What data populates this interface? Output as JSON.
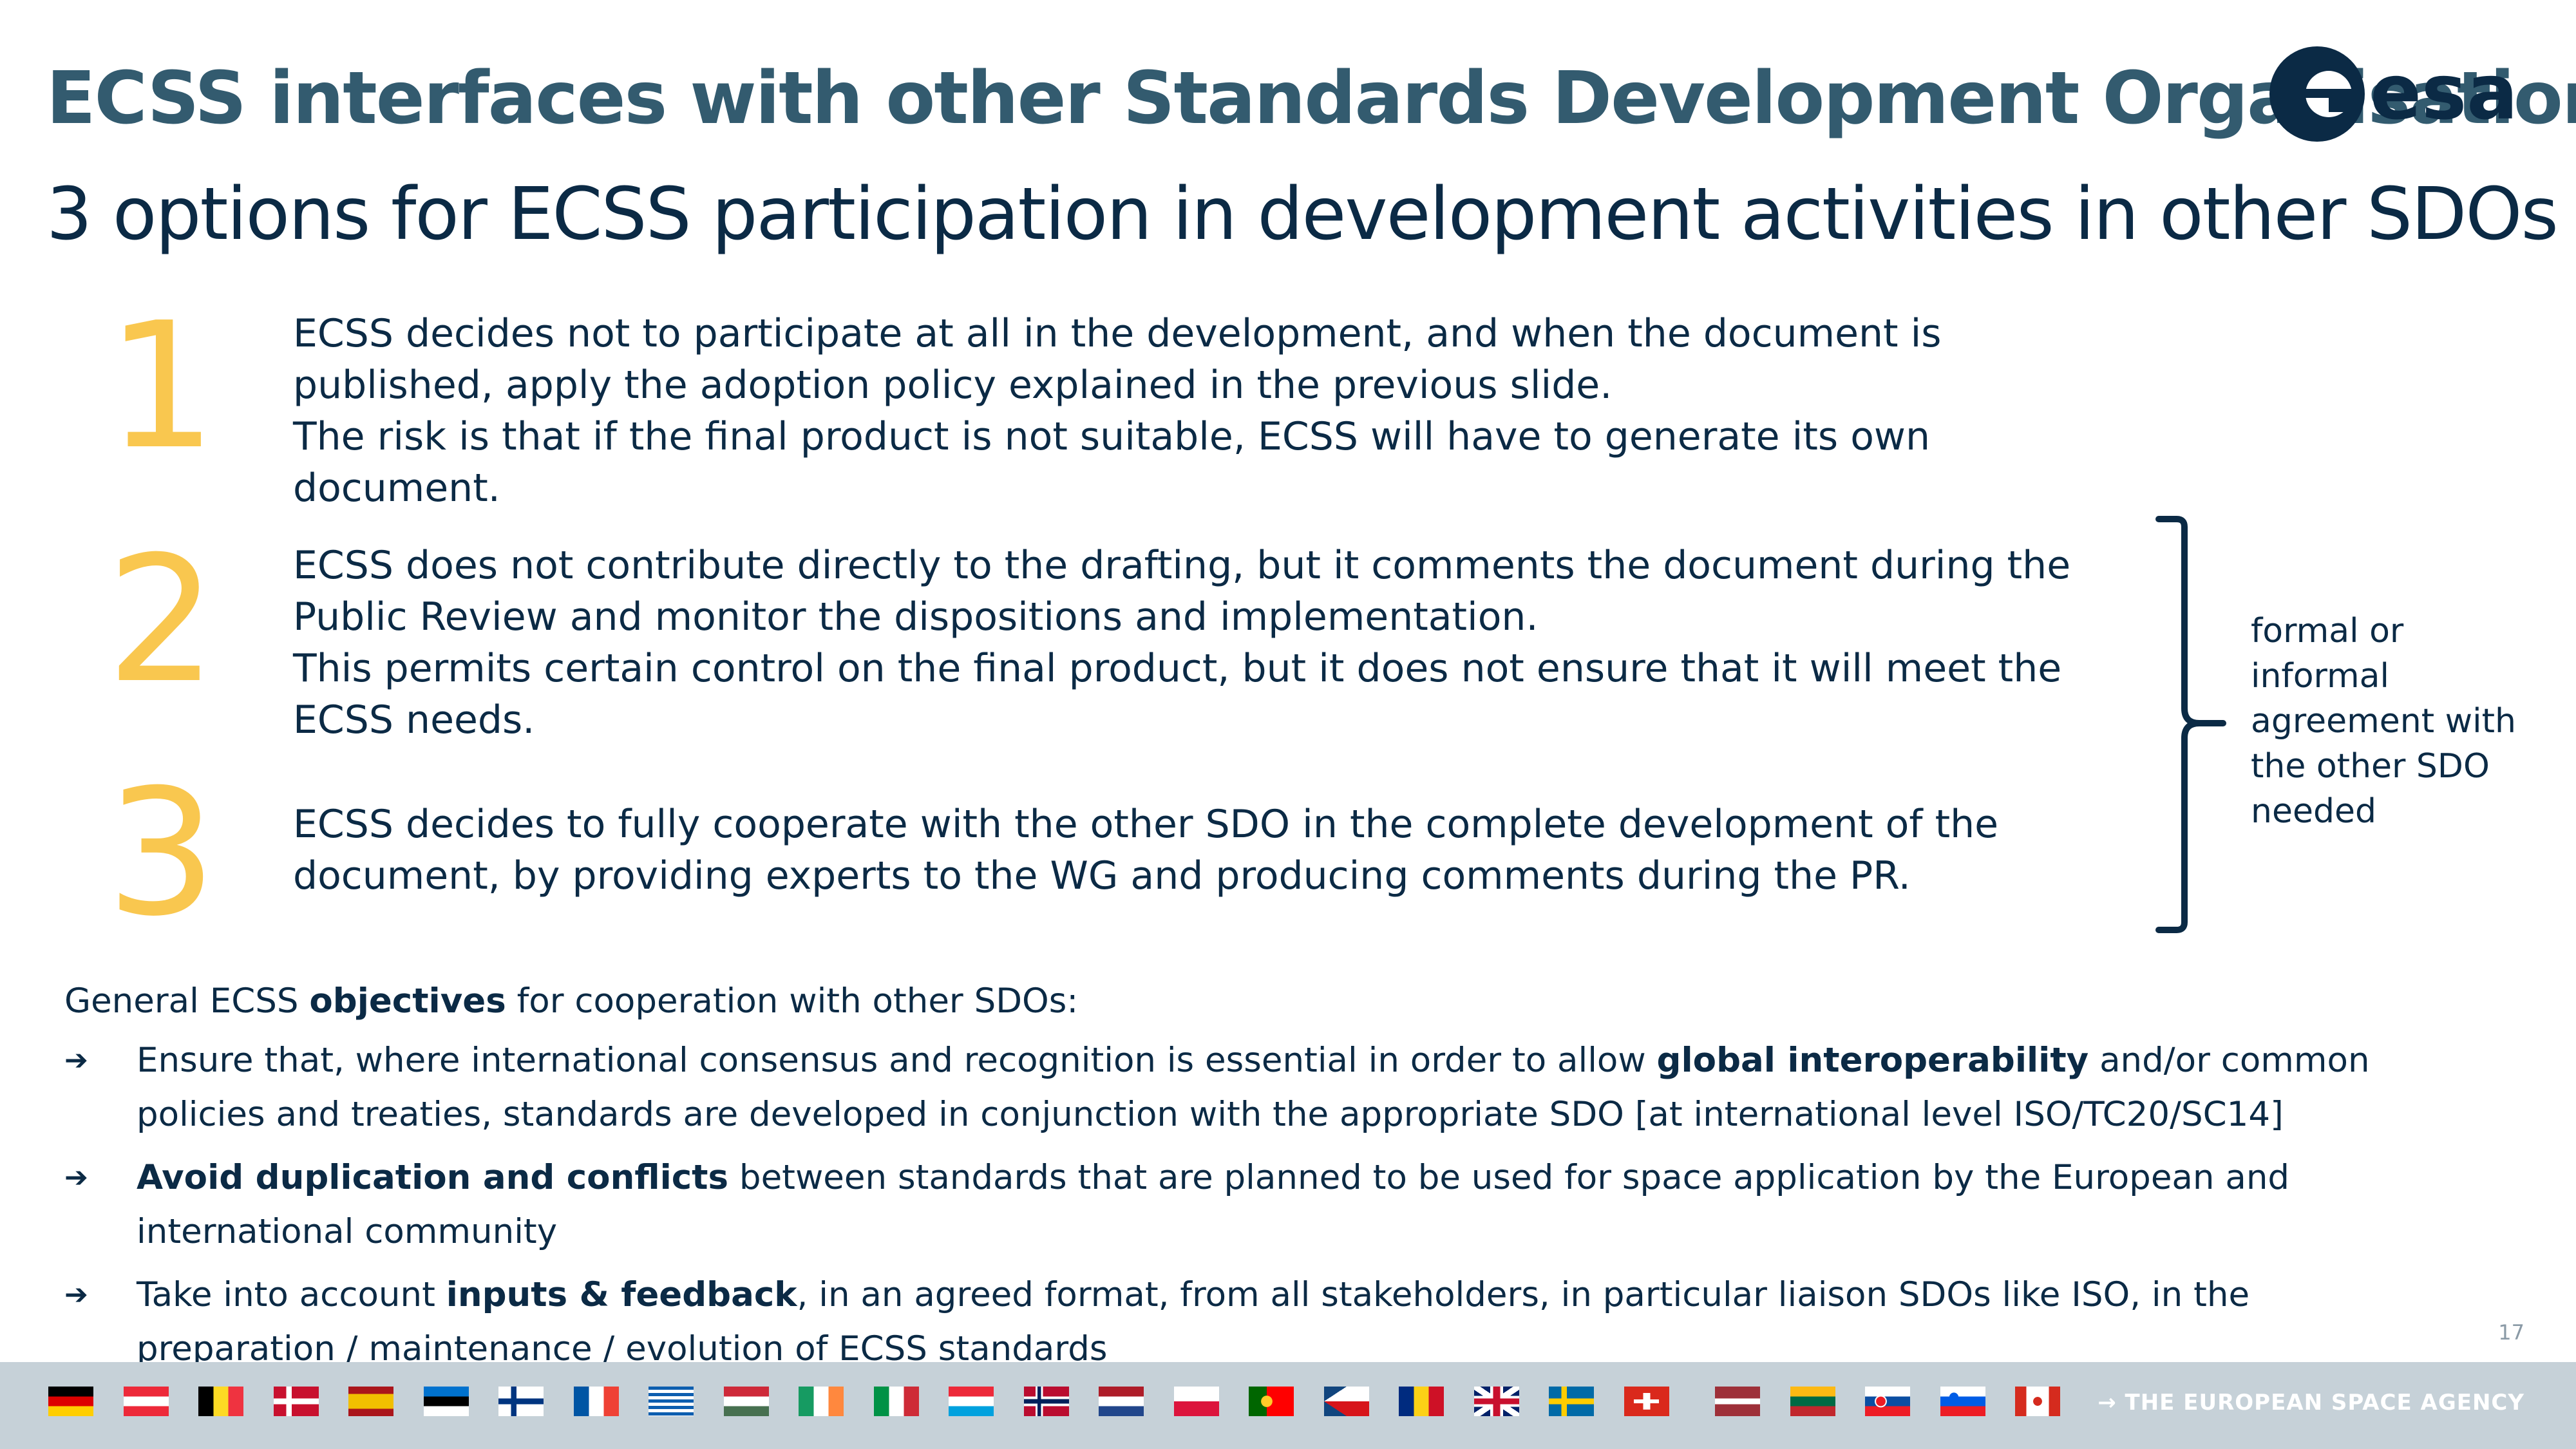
{
  "header": {
    "title": "ECSS interfaces with other Standards Development Organisations",
    "subtitle": "3 options for ECSS participation in development activities in other SDOs",
    "logo_text": "esa"
  },
  "options": [
    {
      "number": "1",
      "lines": [
        "ECSS decides not to participate at all in the development, and when the document is published, apply the adoption policy explained in the previous slide.",
        "The risk is that if the final product is not suitable, ECSS will have to generate its own document."
      ]
    },
    {
      "number": "2",
      "lines": [
        "ECSS does not contribute directly to the drafting, but it comments the document during the Public Review and monitor the dispositions and implementation.",
        "This permits certain control on the final product, but it does not ensure that it will meet the ECSS needs."
      ]
    },
    {
      "number": "3",
      "lines": [
        "ECSS decides to fully cooperate with the other SDO in the complete development of the document, by providing experts to the WG and producing comments during the PR."
      ]
    }
  ],
  "bracket_note": "formal or informal agreement with the other SDO needed",
  "objectives": {
    "heading_prefix": "General ECSS ",
    "heading_bold": "objectives",
    "heading_suffix": " for cooperation with other SDOs:",
    "bullet_glyph": "➔",
    "items": [
      {
        "before": "Ensure that, where international consensus and recognition is essential in order to allow ",
        "bold": "global interoperability",
        "after": " and/or common policies and treaties, standards are developed in conjunction with the appropriate SDO [at international level ISO/TC20/SC14]"
      },
      {
        "before": "",
        "bold": "Avoid duplication and conflicts",
        "after": " between standards that are planned to be used for space application by the European and international community"
      },
      {
        "before": "Take into account ",
        "bold": "inputs & feedback",
        "after": ", in an agreed format, from all stakeholders, in particular liaison SDOs like ISO, in the preparation / maintenance / evolution of ECSS standards"
      }
    ]
  },
  "page_number": "17",
  "footer": {
    "agency": "→ THE EUROPEAN SPACE AGENCY",
    "flags": [
      "Germany",
      "Austria",
      "Belgium",
      "Denmark",
      "Spain",
      "Estonia",
      "Finland",
      "France",
      "Greece",
      "Hungary",
      "Ireland",
      "Italy",
      "Luxembourg",
      "Norway",
      "Netherlands",
      "Poland",
      "Portugal",
      "Czech Republic",
      "Romania",
      "United Kingdom",
      "Sweden",
      "Switzerland",
      "Latvia",
      "Lithuania",
      "Slovakia",
      "Slovenia",
      "Canada"
    ]
  },
  "colors": {
    "title": "#335b6f",
    "text": "#0b2a45",
    "number": "#f9c74f",
    "footer_bg": "#c6d1d8"
  }
}
